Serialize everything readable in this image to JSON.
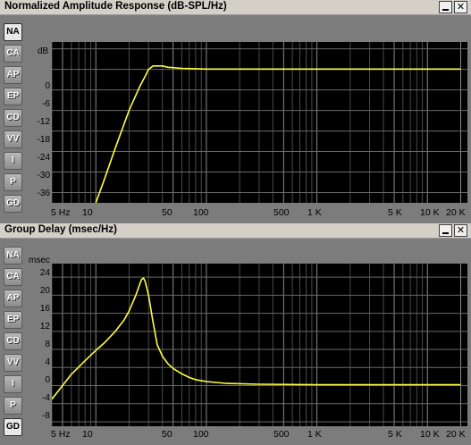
{
  "panels": [
    {
      "title": "Normalized Amplitude Response (dB-SPL/Hz)",
      "unit": "dB",
      "yticks": [
        "0",
        "-6",
        "-12",
        "-18",
        "-24",
        "-30",
        "-36"
      ],
      "tabs": [
        "NA",
        "CA",
        "AP",
        "EP",
        "CD",
        "VV",
        "I",
        "P",
        "GD"
      ],
      "active_tab": "NA"
    },
    {
      "title": "Group Delay (msec/Hz)",
      "unit": "msec",
      "yticks": [
        "24",
        "20",
        "16",
        "12",
        "8",
        "4",
        "0",
        "-4",
        "-8"
      ],
      "tabs": [
        "NA",
        "CA",
        "AP",
        "EP",
        "CD",
        "VV",
        "I",
        "P",
        "GD"
      ],
      "active_tab": "GD"
    }
  ],
  "xticks": [
    "5 Hz",
    "10",
    "50",
    "100",
    "500",
    "1 K",
    "5 K",
    "10 K",
    "20 K"
  ],
  "window_buttons": {
    "close": "✕"
  },
  "trace_color": "#ffff40",
  "chart_data": [
    {
      "type": "line",
      "title": "Normalized Amplitude Response (dB-SPL/Hz)",
      "xscale": "log",
      "xlim": [
        4,
        23000
      ],
      "ylim": [
        -39,
        8
      ],
      "ylabel": "dB",
      "series": [
        {
          "x": [
            10,
            12,
            15,
            20,
            25,
            28,
            30,
            33,
            36,
            40,
            45,
            50,
            60,
            80,
            100,
            1000,
            20000
          ],
          "y": [
            -39,
            -32,
            -23,
            -12,
            -5,
            -2,
            0,
            1,
            1,
            1,
            0.6,
            0.5,
            0.3,
            0.2,
            0.1,
            0.1,
            0.1
          ]
        }
      ]
    },
    {
      "type": "line",
      "title": "Group Delay (msec/Hz)",
      "xscale": "log",
      "xlim": [
        4,
        23000
      ],
      "ylim": [
        -9,
        27
      ],
      "ylabel": "msec",
      "series": [
        {
          "x": [
            4,
            5,
            6,
            8,
            10,
            12,
            15,
            18,
            20,
            23,
            25,
            26,
            27,
            28,
            30,
            33,
            36,
            40,
            45,
            50,
            60,
            70,
            80,
            100,
            150,
            300,
            1000,
            20000
          ],
          "y": [
            -3,
            0,
            2.5,
            5.5,
            7.8,
            9.5,
            12,
            14.5,
            16.5,
            20,
            22.5,
            23.5,
            23.8,
            23,
            20,
            14,
            9,
            6.5,
            4.8,
            3.8,
            2.6,
            1.8,
            1.3,
            0.9,
            0.5,
            0.3,
            0.2,
            0.2
          ]
        }
      ]
    }
  ]
}
